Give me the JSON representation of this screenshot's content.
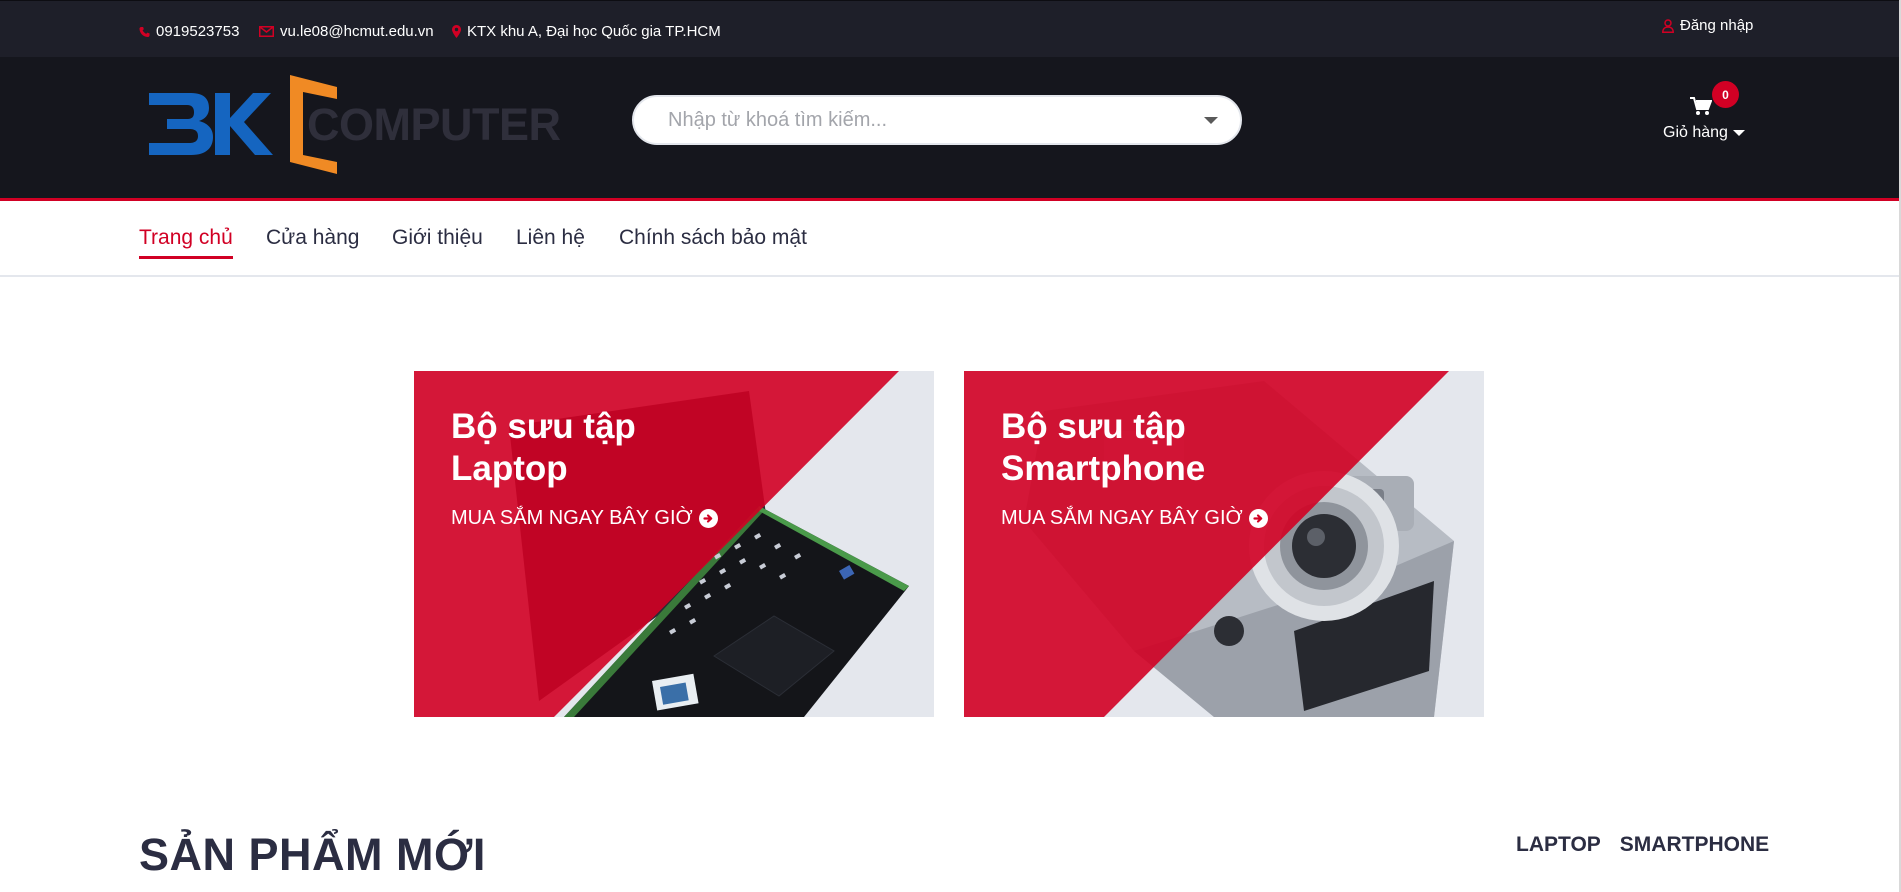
{
  "topbar": {
    "phone": "0919523753",
    "email": "vu.le08@hcmut.edu.vn",
    "address": "KTX khu A, Đại học Quốc gia TP.HCM",
    "login_label": "Đăng nhập",
    "icons": [
      "phone-icon",
      "envelope-icon",
      "map-marker-icon",
      "user-icon"
    ]
  },
  "header": {
    "logo": {
      "mark": "BK",
      "word": "COMPUTER"
    },
    "search": {
      "placeholder": "Nhập từ khoá tìm kiếm..."
    },
    "cart": {
      "count": "0",
      "label": "Giỏ hàng"
    }
  },
  "nav": {
    "items": [
      {
        "label": "Trang chủ",
        "active": true
      },
      {
        "label": "Cửa hàng",
        "active": false
      },
      {
        "label": "Giới thiệu",
        "active": false
      },
      {
        "label": "Liên hệ",
        "active": false
      },
      {
        "label": "Chính sách bảo mật",
        "active": false
      }
    ]
  },
  "banners": [
    {
      "title_line1": "Bộ sưu tập",
      "title_line2": "Laptop",
      "cta": "MUA SẮM NGAY BÂY GIỜ"
    },
    {
      "title_line1": "Bộ sưu tập",
      "title_line2": "Smartphone",
      "cta": "MUA SẮM NGAY BÂY GIỜ"
    }
  ],
  "new_products": {
    "title": "SẢN PHẨM MỚI",
    "tabs": [
      "LAPTOP",
      "SMARTPHONE"
    ]
  },
  "colors": {
    "accent": "#D10024",
    "topbar_bg": "#1E1F29",
    "header_bg": "#15161D",
    "text": "#2B2D42",
    "logo_blue": "#1565C0",
    "logo_orange": "#F08A24"
  }
}
